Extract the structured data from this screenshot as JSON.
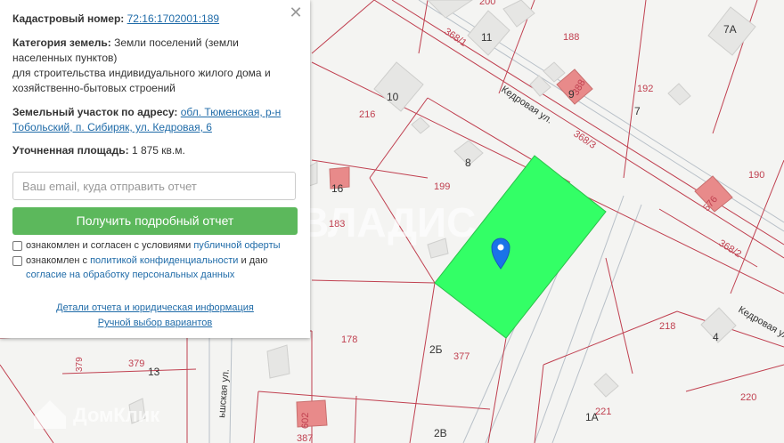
{
  "panel": {
    "close_label": "✕",
    "cadastral_label": "Кадастровый номер:",
    "cadastral_value": "72:16:1702001:189",
    "category_label": "Категория земель:",
    "category_line1": "Земли поселений (земли",
    "category_line2": "населенных пунктов)",
    "purpose_line1": "для строительства индивидуального жилого дома и",
    "purpose_line2": "хозяйственно-бытовых строений",
    "address_label": "Земельный участок по адресу:",
    "address_part1": "обл. Тюменская, р-н",
    "address_part2": "Тобольский, п. Сибиряк, ул. Кедровая, 6",
    "area_label": "Уточненная площадь:",
    "area_value": "1 875 кв.м.",
    "email_placeholder": "Ваш e‌mail, куда отправить отчет",
    "report_button": "Получить подробный отчет",
    "agree1_text": "ознакомлен и согласен с условиями",
    "agree1_link": "публичной оферты",
    "agree2_text": "ознакомлен с",
    "agree2_link": "политикой конфиденциальности",
    "agree2_text2": "и даю",
    "agree2_link2": "согласие на обработку персональных данных",
    "details_link": "Детали отчета и юридическая информация",
    "manual_link": "Ручной выбор вариантов"
  },
  "map": {
    "watermark": "ВЛАДИС",
    "watermark2": "ДомКлик",
    "streets": [
      "Кедровая ул.",
      "Кедровая ул",
      "ьшская ул."
    ],
    "parcel_numbers": [
      "200",
      "188",
      "192",
      "216",
      "199",
      "183",
      "178",
      "377",
      "379",
      "221",
      "218",
      "220",
      "190",
      "368/1",
      "368/3",
      "368/2",
      "388",
      "576",
      "387",
      "602"
    ],
    "house_numbers": [
      "11",
      "7А",
      "7",
      "10",
      "8",
      "16",
      "13",
      "2Б",
      "2В",
      "1А",
      "4",
      "9"
    ],
    "colors": {
      "parcel_fill": "#33ff66",
      "boundary": "#c04050",
      "building": "#e8e8e6",
      "building_red": "#e88a8a",
      "pin": "#1a73e8"
    }
  }
}
